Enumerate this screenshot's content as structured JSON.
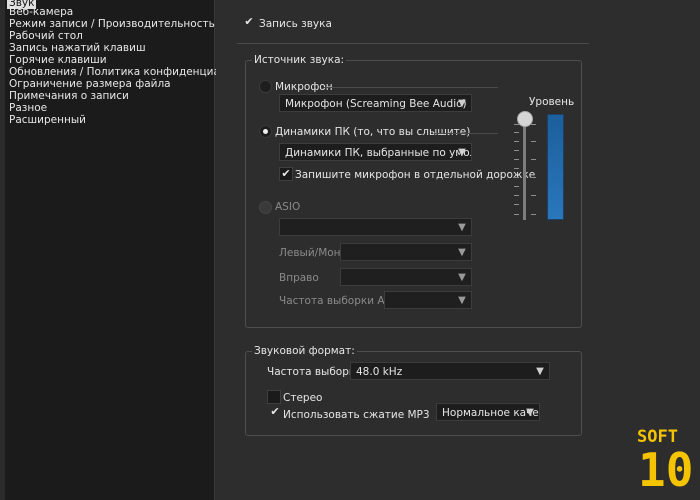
{
  "sidebar": {
    "items": [
      {
        "label": "Звук",
        "selected": true
      },
      {
        "label": "Веб-камера"
      },
      {
        "label": "Режим записи / Производительность"
      },
      {
        "label": "Рабочий стол"
      },
      {
        "label": "Запись нажатий клавиш"
      },
      {
        "label": "Горячие клавиши"
      },
      {
        "label": "Обновления / Политика конфиденциальности"
      },
      {
        "label": "Ограничение размера файла"
      },
      {
        "label": "Примечания о записи"
      },
      {
        "label": "Разное"
      },
      {
        "label": "Расширенный"
      }
    ]
  },
  "main": {
    "record_audio": {
      "label": "Запись звука",
      "checked": true
    },
    "source": {
      "title": "Источник звука:",
      "microphone": {
        "label": "Микрофон",
        "selected": false,
        "device": "Микрофон (Screaming Bee Audio)"
      },
      "speakers": {
        "label": "Динамики ПК (то, что вы слышите)",
        "selected": true,
        "device": "Динамики ПК, выбранные по умолчанию"
      },
      "separate_track": {
        "label": "Запишите микрофон в отдельной дорожке",
        "checked": true
      },
      "asio": {
        "label": "ASIO",
        "left_mono": "Левый/Моно",
        "right": "Вправо",
        "sample_rate": "Частота выборки ASIO"
      },
      "level": {
        "label": "Уровень",
        "value": 1.0
      }
    },
    "format": {
      "title": "Звуковой формат:",
      "sample_rate_label": "Частота выборки:",
      "sample_rate_value": "48.0 kHz",
      "stereo": {
        "label": "Стерео",
        "checked": false
      },
      "mp3": {
        "label": "Использовать сжатие MP3",
        "checked": true
      },
      "quality": "Нормальное качест"
    }
  },
  "logo": {
    "line1": "SOFT",
    "line2": "10"
  },
  "colors": {
    "accent_meter": "#2a77bc",
    "logo": "#f5c400"
  }
}
